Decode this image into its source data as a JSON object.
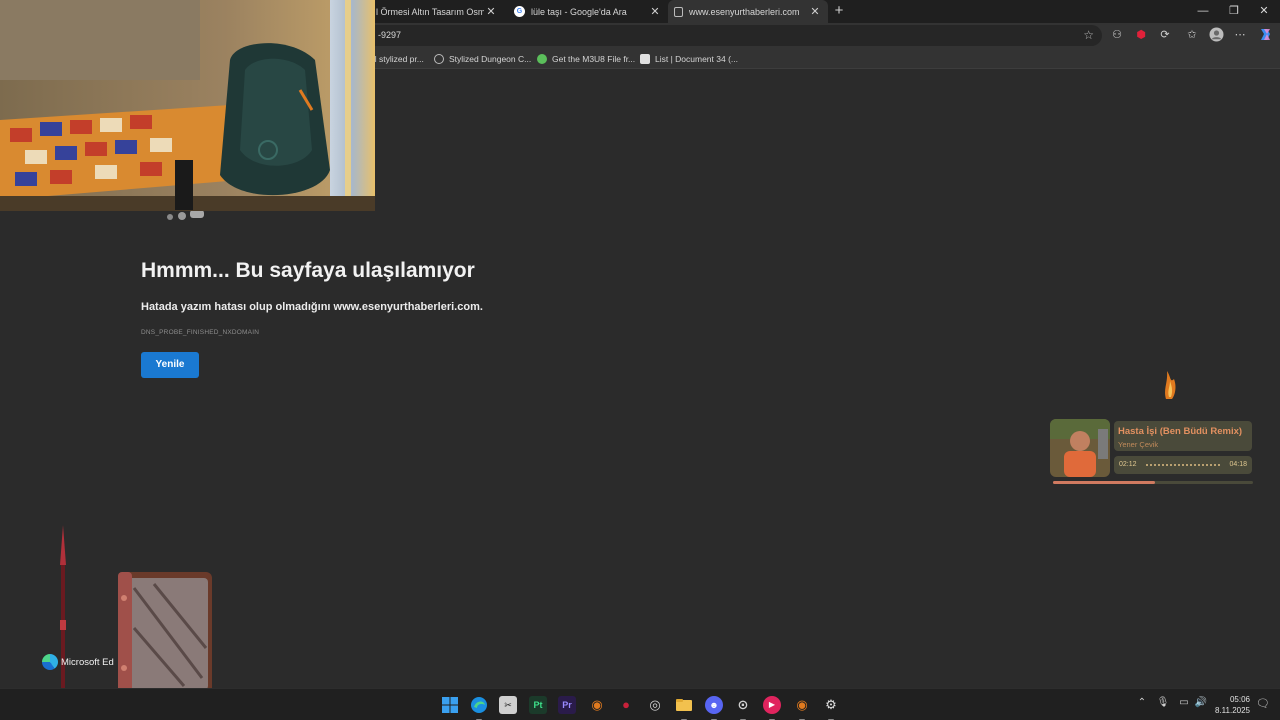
{
  "tabs": [
    {
      "title": "l Örmesi Altın Tasarım Osmanlı F",
      "active": false,
      "favicon_color": "#5a5a5a"
    },
    {
      "title": "lüle taşı - Google'da Ara",
      "active": false,
      "favicon_color": "#4285f4"
    },
    {
      "title": "www.esenyurthaberleri.com",
      "active": true,
      "favicon_color": "#9a9a9a"
    }
  ],
  "address_bar": {
    "url": "-9297"
  },
  "bookmarks": [
    {
      "label": "al stylized pr...",
      "icon_color": "#444444"
    },
    {
      "label": "Stylized Dungeon C...",
      "icon_color": "#bbbbbb"
    },
    {
      "label": "Get the M3U8 File fr...",
      "icon_color": "#5bbf5b"
    },
    {
      "label": "List | Document 34 (...",
      "icon_color": "#e0e0e0"
    }
  ],
  "error_page": {
    "title": "Hmmm... Bu sayfaya ulaşılamıyor",
    "description": "Hatada yazım hatası olup olmadığını www.esenyurthaberleri.com.",
    "error_code": "DNS_PROBE_FINISHED_NXDOMAIN",
    "reload_label": "Yenile"
  },
  "music_widget": {
    "song": "Hasta İşi (Ben Büdü Remix)",
    "artist": "Yener Çevik",
    "elapsed": "02:12",
    "duration": "04:18",
    "progress_fraction": 0.51,
    "accent": "#e29060"
  },
  "edge_label": "Microsoft Ed",
  "clock": {
    "time": "05:06",
    "date": "8.11.2025"
  },
  "taskbar_apps": [
    {
      "name": "start",
      "color": "#3aa0f0",
      "glyph": ""
    },
    {
      "name": "edge",
      "color": "#1a8fe0",
      "glyph": ""
    },
    {
      "name": "sniper",
      "color": "#cccccc",
      "glyph": ""
    },
    {
      "name": "painter",
      "color": "#1b3a2a",
      "glyph": "Pt"
    },
    {
      "name": "premiere",
      "color": "#2a1b4a",
      "glyph": "Pr"
    },
    {
      "name": "blender",
      "color": "#e07a1f",
      "glyph": ""
    },
    {
      "name": "app-red",
      "color": "#c8213a",
      "glyph": ""
    },
    {
      "name": "obs",
      "color": "#3a3a3a",
      "glyph": ""
    },
    {
      "name": "files",
      "color": "#f2c14e",
      "glyph": ""
    },
    {
      "name": "discord",
      "color": "#5865f2",
      "glyph": ""
    },
    {
      "name": "steam-like",
      "color": "#3a3a3a",
      "glyph": ""
    },
    {
      "name": "media-player",
      "color": "#e0245e",
      "glyph": ""
    },
    {
      "name": "blender-2",
      "color": "#e07a1f",
      "glyph": ""
    },
    {
      "name": "settings",
      "color": "#2a2a2a",
      "glyph": ""
    }
  ]
}
